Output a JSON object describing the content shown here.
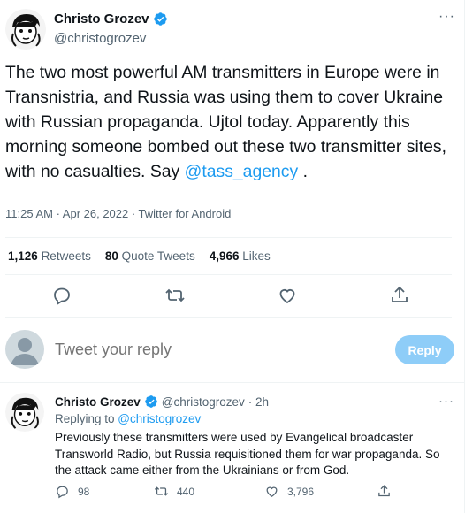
{
  "tweet": {
    "display_name": "Christo Grozev",
    "handle": "@christogrozev",
    "text_before": "The two most powerful AM transmitters in Europe were in Transnistria, and Russia was using them to cover Ukraine with Russian propaganda. Ujtol today. Apparently this morning someone bombed out these two transmitter sites, with no casualties. Say ",
    "mention": "@tass_agency",
    "text_after": " .",
    "meta": "11:25 AM · Apr 26, 2022 · Twitter for Android",
    "stats": {
      "retweets_count": "1,126",
      "retweets_label": "Retweets",
      "quotes_count": "80",
      "quotes_label": "Quote Tweets",
      "likes_count": "4,966",
      "likes_label": "Likes"
    },
    "more_label": "···"
  },
  "compose": {
    "placeholder": "Tweet your reply",
    "reply_button": "Reply"
  },
  "reply_tweet": {
    "display_name": "Christo Grozev",
    "handle": "@christogrozev",
    "time": "· 2h",
    "replying_prefix": "Replying to ",
    "replying_to": "@christogrozev",
    "text": "Previously these transmitters were used by Evangelical broadcaster Transworld Radio, but Russia requisitioned them for war propaganda. So the attack came  either from the Ukrainians or from God.",
    "replies": "98",
    "retweets": "440",
    "likes": "3,796",
    "more_label": "···"
  },
  "colors": {
    "accent": "#1d9bf0",
    "reply_button_disabled": "#8ecdf8",
    "secondary_text": "#536471"
  },
  "icons": [
    "verified-badge-icon",
    "reply-icon",
    "retweet-icon",
    "like-icon",
    "share-icon",
    "more-icon"
  ]
}
